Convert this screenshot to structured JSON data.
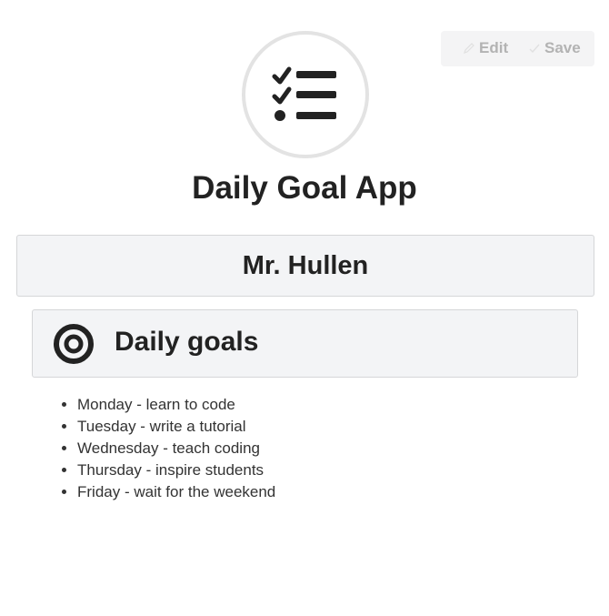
{
  "toolbar": {
    "edit_label": "Edit",
    "save_label": "Save",
    "edit_icon": "pencil-icon",
    "save_icon": "checkmark-icon"
  },
  "header": {
    "logo_icon": "checklist-icon",
    "title": "Daily Goal App"
  },
  "user": {
    "name": "Mr. Hullen"
  },
  "goals": {
    "icon": "target-icon",
    "title": "Daily goals",
    "items": [
      "Monday - learn to code",
      "Tuesday - write a tutorial",
      "Wednesday - teach coding",
      "Thursday - inspire students",
      "Friday - wait for the weekend"
    ]
  },
  "colors": {
    "panel_bg": "#f3f4f6",
    "panel_border": "#d5d6d8",
    "text": "#222222",
    "toolbar_text": "#b3b3b3"
  }
}
